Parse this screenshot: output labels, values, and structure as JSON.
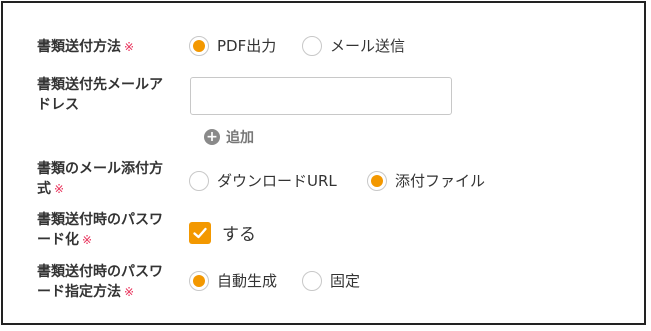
{
  "colors": {
    "accent": "#f39800",
    "required": "#e8315a",
    "text": "#333333"
  },
  "required_mark": "※",
  "delivery_method": {
    "label": "書類送付方法",
    "required": true,
    "options": [
      {
        "label": "PDF出力",
        "selected": true
      },
      {
        "label": "メール送信",
        "selected": false
      }
    ]
  },
  "email_address": {
    "label_line1": "書類送付先メールア",
    "label_line2": "ドレス",
    "value": "",
    "placeholder": "",
    "add_label": "追加",
    "add_icon": "plus-circle-icon"
  },
  "attachment_method": {
    "label_line1": "書類のメール添付方",
    "label_line2": "式",
    "required": true,
    "options": [
      {
        "label": "ダウンロードURL",
        "selected": false
      },
      {
        "label": "添付ファイル",
        "selected": true
      }
    ]
  },
  "password_protect": {
    "label_line1": "書類送付時のパスワ",
    "label_line2": "ード化",
    "required": true,
    "checkbox_label": "する",
    "checked": true
  },
  "password_method": {
    "label_line1": "書類送付時のパスワ",
    "label_line2": "ード指定方法",
    "required": true,
    "options": [
      {
        "label": "自動生成",
        "selected": true
      },
      {
        "label": "固定",
        "selected": false
      }
    ]
  }
}
